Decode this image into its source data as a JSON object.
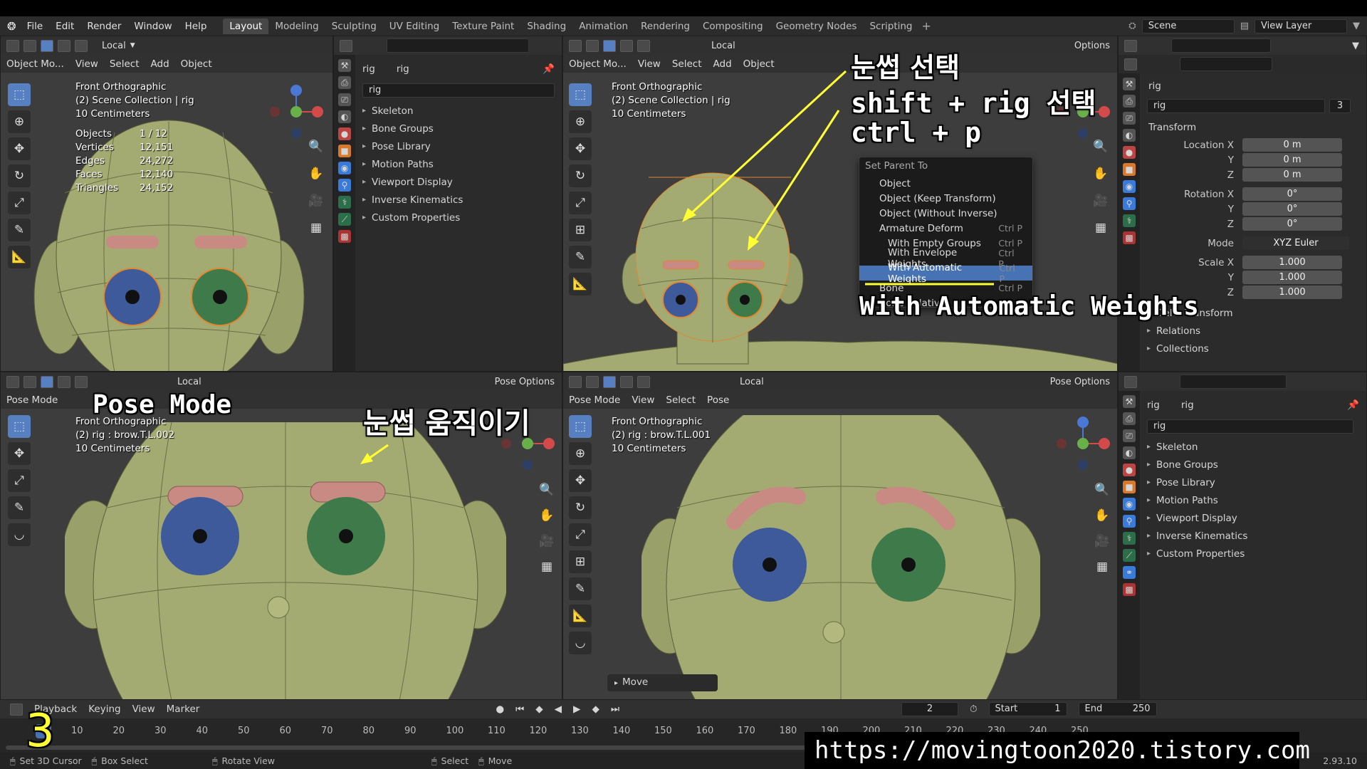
{
  "topbar": {
    "menus": [
      "File",
      "Edit",
      "Render",
      "Window",
      "Help"
    ],
    "workspaces": [
      "Layout",
      "Modeling",
      "Sculpting",
      "UV Editing",
      "Texture Paint",
      "Shading",
      "Animation",
      "Rendering",
      "Compositing",
      "Geometry Nodes",
      "Scripting"
    ],
    "active_workspace": "Layout",
    "scene": "Scene",
    "view_layer": "View Layer"
  },
  "vp1": {
    "transform": "Local",
    "mode": "Object Mo...",
    "menus": [
      "View",
      "Select",
      "Add",
      "Object"
    ],
    "view": "Front Orthographic",
    "collection": "(2) Scene Collection | rig",
    "scale": "10 Centimeters",
    "stats": [
      {
        "k": "Objects",
        "v": "1 / 12"
      },
      {
        "k": "Vertices",
        "v": "12,151"
      },
      {
        "k": "Edges",
        "v": "24,272"
      },
      {
        "k": "Faces",
        "v": "12,140"
      },
      {
        "k": "Triangles",
        "v": "24,152"
      }
    ]
  },
  "props1": {
    "object": "rig",
    "data": "rig",
    "datablock": "rig",
    "sections": [
      "Skeleton",
      "Bone Groups",
      "Pose Library",
      "Motion Paths",
      "Viewport Display",
      "Inverse Kinematics",
      "Custom Properties"
    ]
  },
  "vp2": {
    "transform": "Local",
    "options": "Options",
    "mode": "Object Mo...",
    "menus": [
      "View",
      "Select",
      "Add",
      "Object"
    ],
    "view": "Front Orthographic",
    "collection": "(2) Scene Collection | rig",
    "scale": "10 Centimeters"
  },
  "context_menu": {
    "title": "Set Parent To",
    "items": [
      {
        "label": "Object",
        "shortcut": "",
        "sub": false
      },
      {
        "label": "Object (Keep Transform)",
        "shortcut": "",
        "sub": false
      },
      {
        "label": "Object (Without Inverse)",
        "shortcut": "",
        "sub": false
      },
      {
        "label": "Armature Deform",
        "shortcut": "Ctrl P",
        "sub": false
      },
      {
        "label": "With Empty Groups",
        "shortcut": "Ctrl P",
        "sub": true
      },
      {
        "label": "With Envelope Weights",
        "shortcut": "Ctrl P",
        "sub": true
      },
      {
        "label": "With Automatic Weights",
        "shortcut": "Ctrl P",
        "sub": true
      },
      {
        "label": "Bone",
        "shortcut": "Ctrl P",
        "sub": false
      },
      {
        "label": "Bone Relative",
        "shortcut": "",
        "sub": false
      }
    ],
    "highlighted": "With Automatic Weights"
  },
  "annotations": {
    "line1": "눈썹 선택",
    "line2": "shift + rig 선택",
    "line3": "ctrl + p",
    "auto_weights": "With Automatic Weights",
    "pose_mode": "Pose Mode",
    "move_brow": "눈썹 움직이기",
    "step": "3",
    "url": "https://movingtoon2020.tistory.com"
  },
  "props2": {
    "object": "rig",
    "datablock": "rig",
    "users": "3",
    "transform_title": "Transform",
    "location": [
      {
        "axis": "Location X",
        "v": "0 m"
      },
      {
        "axis": "Y",
        "v": "0 m"
      },
      {
        "axis": "Z",
        "v": "0 m"
      }
    ],
    "rotation": [
      {
        "axis": "Rotation X",
        "v": "0°"
      },
      {
        "axis": "Y",
        "v": "0°"
      },
      {
        "axis": "Z",
        "v": "0°"
      }
    ],
    "mode_label": "Mode",
    "mode_value": "XYZ Euler",
    "scale": [
      {
        "axis": "Scale X",
        "v": "1.000"
      },
      {
        "axis": "Y",
        "v": "1.000"
      },
      {
        "axis": "Z",
        "v": "1.000"
      }
    ],
    "sections": [
      "Delta Transform",
      "Relations",
      "Collections"
    ]
  },
  "vp3": {
    "transform": "Local",
    "pose_options": "Pose Options",
    "mode": "Pose Mode",
    "view": "Front Orthographic",
    "bone": "(2) rig : brow.T.L.002",
    "scale": "10 Centimeters"
  },
  "vp4": {
    "transform": "Local",
    "pose_options": "Pose Options",
    "mode": "Pose Mode",
    "menus": [
      "View",
      "Select",
      "Pose"
    ],
    "view": "Front Orthographic",
    "bone": "(2) rig : brow.T.L.001",
    "scale": "10 Centimeters",
    "move_panel": "Move"
  },
  "props3": {
    "object": "rig",
    "data": "rig",
    "datablock": "rig",
    "sections": [
      "Skeleton",
      "Bone Groups",
      "Pose Library",
      "Motion Paths",
      "Viewport Display",
      "Inverse Kinematics",
      "Custom Properties"
    ]
  },
  "timeline": {
    "menus": [
      "Playback",
      "Keying",
      "View",
      "Marker"
    ],
    "current_frame": "2",
    "start_label": "Start",
    "start": "1",
    "end_label": "End",
    "end": "250",
    "ticks": [
      "10",
      "20",
      "30",
      "40",
      "50",
      "60",
      "70",
      "80",
      "90",
      "100",
      "110",
      "120",
      "130",
      "140",
      "150",
      "160",
      "170",
      "180",
      "190",
      "200",
      "210",
      "220",
      "230",
      "240",
      "250"
    ]
  },
  "status": {
    "items": [
      "Set 3D Cursor",
      "Box Select",
      "Rotate View",
      "Select",
      "Move"
    ],
    "version": "2.93.10"
  },
  "colors": {
    "select_blue": "#4772b3",
    "annotation_yellow": "#ffff33",
    "skin": "#9aa06a",
    "brow": "#c98a83"
  }
}
